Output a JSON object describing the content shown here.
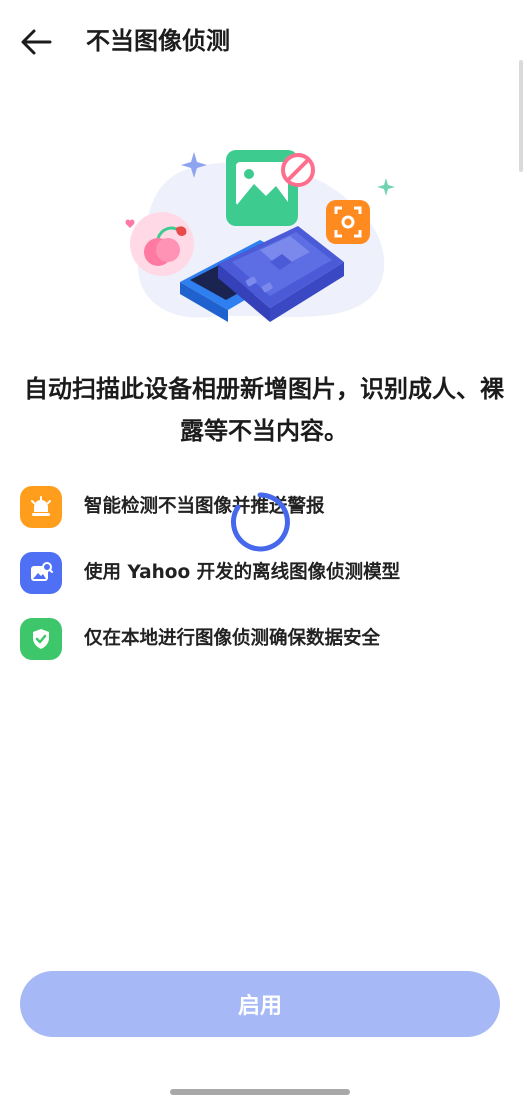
{
  "header": {
    "title": "不当图像侦测",
    "back_icon": "arrow-left-icon"
  },
  "illustration": {
    "name": "device-scan-illustration",
    "colors": {
      "blob": "#eef1fb",
      "phone_back": "#2f7ff0",
      "phone_front": "#4b5bd8",
      "photo_tile": "#3ecb8f",
      "prohibit_badge": "#ff6f8d",
      "face_scan_badge": "#ff8a1f",
      "peach_bubble": "#ffd9e6"
    }
  },
  "description": "自动扫描此设备相册新增图片，识别成人、裸露等不当内容。",
  "features": [
    {
      "icon": "alarm-siren-icon",
      "icon_bg": "#ff9d1c",
      "text": "智能检测不当图像并推送警报"
    },
    {
      "icon": "image-search-icon",
      "icon_bg": "#4f6ff5",
      "text": "使用 Yahoo 开发的离线图像侦测模型"
    },
    {
      "icon": "shield-check-icon",
      "icon_bg": "#3ec76a",
      "text": "仅在本地进行图像侦测确保数据安全"
    }
  ],
  "loading": {
    "icon": "loading-spinner-icon",
    "color": "#4669ec"
  },
  "enable_button": {
    "label": "启用",
    "bg": "#a6b9f6"
  }
}
